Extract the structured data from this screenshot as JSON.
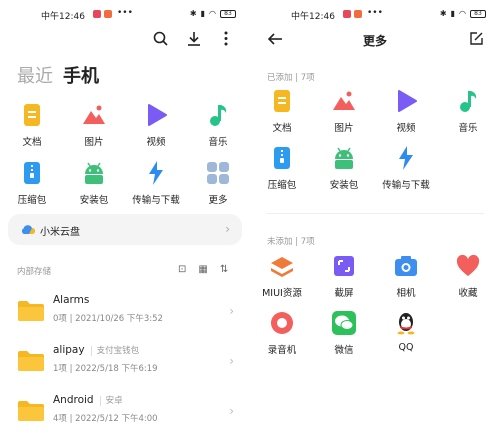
{
  "status_bar": {
    "time": "中午12:46",
    "battery": "83"
  },
  "left": {
    "tabs": [
      {
        "label": "最近"
      },
      {
        "label": "手机"
      }
    ],
    "categories": [
      {
        "label": "文档",
        "icon": "document-icon",
        "color": "#f5b823"
      },
      {
        "label": "图片",
        "icon": "picture-icon",
        "color": "#f25f5c"
      },
      {
        "label": "视频",
        "icon": "video-icon",
        "color": "#7a5cf5"
      },
      {
        "label": "音乐",
        "icon": "music-icon",
        "color": "#25c48a"
      },
      {
        "label": "压缩包",
        "icon": "archive-icon",
        "color": "#2d9cf0"
      },
      {
        "label": "安装包",
        "icon": "apk-icon",
        "color": "#3fc07a"
      },
      {
        "label": "传输与下载",
        "icon": "transfer-icon",
        "color": "#2d8cf0"
      },
      {
        "label": "更多",
        "icon": "more-grid-icon",
        "color": "#9fb7d9"
      }
    ],
    "cloud_label": "小米云盘",
    "storage_title": "内部存储",
    "folders": [
      {
        "name": "Alarms",
        "tag": "",
        "meta": "0项 | 2021/10/26 下午3:52"
      },
      {
        "name": "alipay",
        "tag": "支付宝钱包",
        "meta": "1项 | 2022/5/18 下午6:19"
      },
      {
        "name": "Android",
        "tag": "安卓",
        "meta": "4项 | 2022/5/12 下午4:00"
      }
    ]
  },
  "right": {
    "title": "更多",
    "added_title": "已添加 | 7项",
    "added": [
      {
        "label": "文档",
        "icon": "document-icon",
        "color": "#f5b823"
      },
      {
        "label": "图片",
        "icon": "picture-icon",
        "color": "#f25f5c"
      },
      {
        "label": "视频",
        "icon": "video-icon",
        "color": "#7a5cf5"
      },
      {
        "label": "音乐",
        "icon": "music-icon",
        "color": "#25c48a"
      },
      {
        "label": "压缩包",
        "icon": "archive-icon",
        "color": "#2d9cf0"
      },
      {
        "label": "安装包",
        "icon": "apk-icon",
        "color": "#3fc07a"
      },
      {
        "label": "传输与下载",
        "icon": "transfer-icon",
        "color": "#2d8cf0"
      }
    ],
    "not_added_title": "未添加 | 7项",
    "not_added": [
      {
        "label": "MIUI资源",
        "icon": "layers-icon",
        "color": "#f07a3a"
      },
      {
        "label": "截屏",
        "icon": "screenshot-icon",
        "color": "#7a5cf5"
      },
      {
        "label": "相机",
        "icon": "camera-icon",
        "color": "#3d8ef0"
      },
      {
        "label": "收藏",
        "icon": "heart-icon",
        "color": "#f25f5c"
      },
      {
        "label": "录音机",
        "icon": "recorder-icon",
        "color": "#f25f5c"
      },
      {
        "label": "微信",
        "icon": "wechat-icon",
        "color": "#2dc15b"
      },
      {
        "label": "QQ",
        "icon": "qq-icon",
        "color": "#222222"
      }
    ]
  }
}
